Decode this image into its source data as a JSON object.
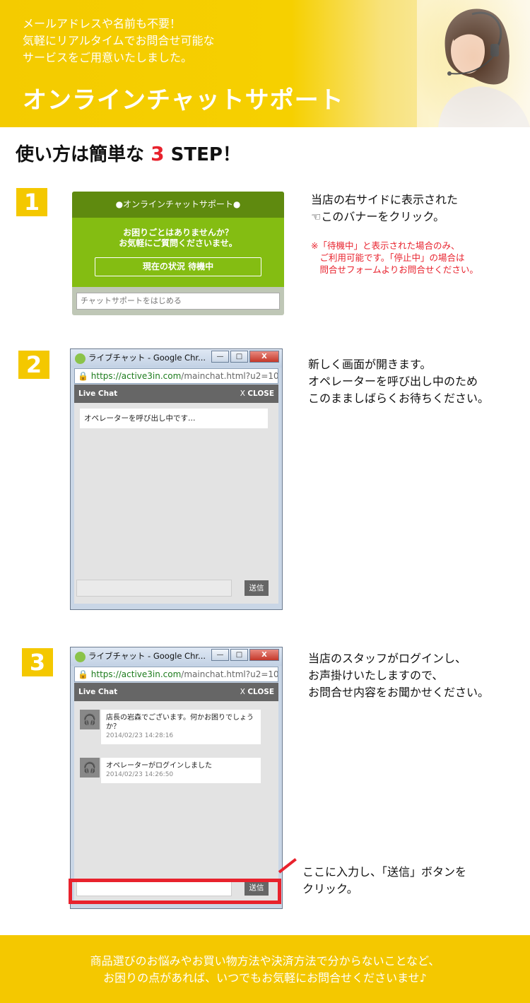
{
  "header": {
    "lines": [
      "メールアドレスや名前も不要！",
      "気軽にリアルタイムでお問合せ可能な",
      "サービスをご用意いたしました。"
    ],
    "title": "オンラインチャットサポート"
  },
  "steps_heading": {
    "prefix": "使い方は簡単な",
    "num": "3",
    "suffix": " STEP！"
  },
  "step1": {
    "badge": "1",
    "banner_title": "●オンラインチャットサポート●",
    "banner_msg_1": "お困りごとはありませんか？",
    "banner_msg_2": "お気軽にご質問くださいませ。",
    "banner_status": "現在の状況 待機中",
    "banner_input": "チャットサポートをはじめる",
    "desc_1": "当店の右サイドに表示された",
    "desc_2": "☜このバナーをクリック。",
    "note_1": "※「待機中」と表示された場合のみ、",
    "note_2": "　ご利用可能です。「停止中」の場合は",
    "note_3": "　問合せフォームよりお問合せください。"
  },
  "window": {
    "title": "ライブチャット - Google Chr...",
    "url_https": "https://",
    "url_host": "active3in.com",
    "url_path": "/mainchat.html?u2=10",
    "chat_label": "Live Chat",
    "close_x": "X",
    "close_label": "CLOSE",
    "send_label": "送信",
    "minimize": "—",
    "maximize": "□",
    "close_btn": "X"
  },
  "step2": {
    "badge": "2",
    "system_msg": "オペレーターを呼び出し中です…",
    "desc_1": "新しく画面が開きます。",
    "desc_2": "オペレーターを呼び出し中のため",
    "desc_3": "このまましばらくお待ちください。"
  },
  "step3": {
    "badge": "3",
    "messages": [
      {
        "text_1": "店長の岩森でございます。何かお困りでしょう",
        "text_2": "か？",
        "time": "2014/02/23 14:28:16"
      },
      {
        "text_1": "オペレーターがログインしました",
        "time": "2014/02/23 14:26:50"
      }
    ],
    "desc_1": "当店のスタッフがログインし、",
    "desc_2": "お声掛けいたしますので、",
    "desc_3": "お問合せ内容をお聞かせください。",
    "hint_1": "ここに入力し、「送信」ボタンを",
    "hint_2": "クリック。"
  },
  "footer": {
    "line_1": "商品選びのお悩みやお買い物方法や決済方法で分からないことなど、",
    "line_2": "お困りの点があれば、いつでもお気軽にお問合せくださいませ♪"
  },
  "colors": {
    "accent": "#f4c800",
    "red": "#e8222d",
    "banner_green": "#84bd12"
  }
}
